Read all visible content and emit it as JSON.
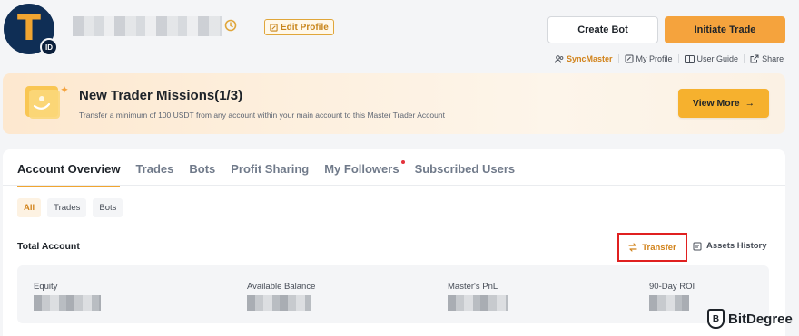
{
  "profile": {
    "avatar_letter": "T",
    "avatar_badge": "ID",
    "edit_label": "Edit Profile"
  },
  "header": {
    "create_bot": "Create Bot",
    "initiate_trade": "Initiate Trade",
    "links": [
      "SyncMaster",
      "My Profile",
      "User Guide",
      "Share"
    ]
  },
  "mission": {
    "title": "New Trader Missions(1/3)",
    "description": "Transfer a minimum of 100 USDT from any account within your main account to this Master Trader Account",
    "button": "View More"
  },
  "tabs": [
    "Account Overview",
    "Trades",
    "Bots",
    "Profit Sharing",
    "My Followers",
    "Subscribed Users"
  ],
  "filters": [
    "All",
    "Trades",
    "Bots"
  ],
  "total": {
    "title": "Total Account",
    "transfer": "Transfer",
    "assets_history": "Assets History"
  },
  "stats": [
    "Equity",
    "Available Balance",
    "Master's PnL",
    "90-Day ROI"
  ],
  "watermark": {
    "text": "BitDegree",
    "shield_letter": "B"
  },
  "colors": {
    "accent": "#f0a531",
    "highlight_box": "#e02020"
  }
}
